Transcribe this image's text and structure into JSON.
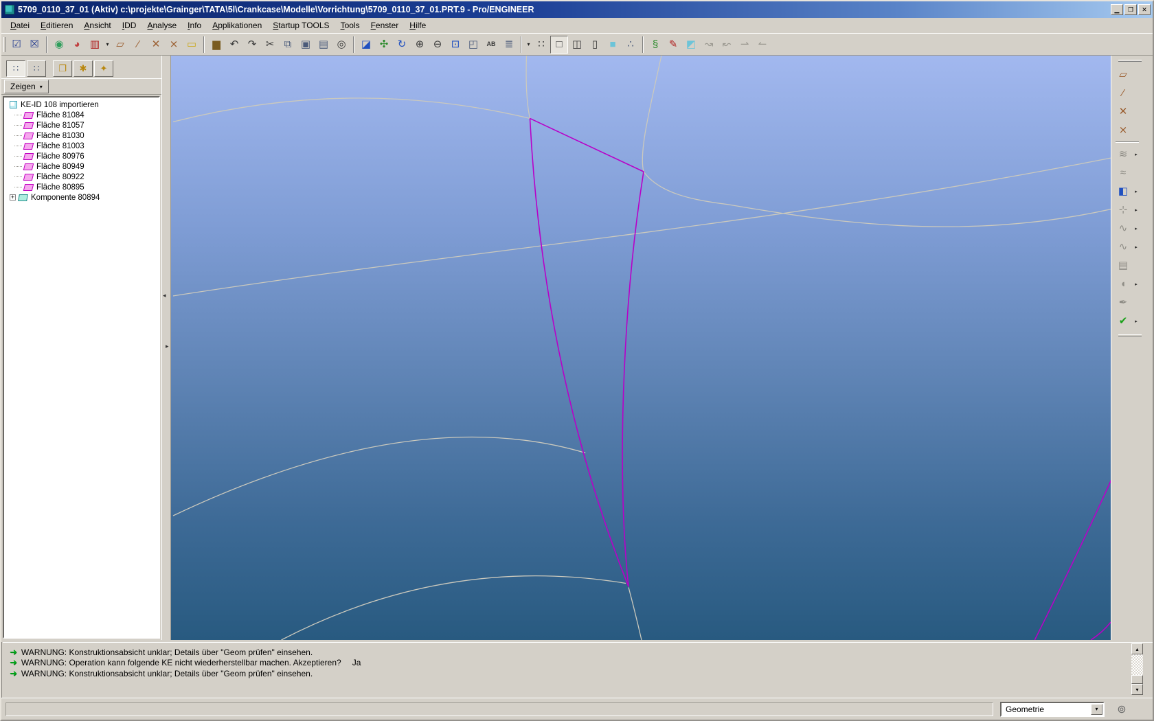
{
  "window": {
    "title": "5709_0110_37_01 (Aktiv) c:\\projekte\\Grainger\\TATA\\5l\\Crankcase\\Modelle\\Vorrichtung\\5709_0110_37_01.PRT.9 - Pro/ENGINEER"
  },
  "menu": {
    "items": [
      {
        "label": "Datei"
      },
      {
        "label": "Editieren"
      },
      {
        "label": "Ansicht"
      },
      {
        "label": "IDD"
      },
      {
        "label": "Analyse"
      },
      {
        "label": "Info"
      },
      {
        "label": "Applikationen"
      },
      {
        "label": "Startup TOOLS"
      },
      {
        "label": "Tools"
      },
      {
        "label": "Fenster"
      },
      {
        "label": "Hilfe"
      }
    ]
  },
  "left_panel": {
    "show_button": "Zeigen"
  },
  "tree": {
    "root_label": "KE-ID 108 importieren",
    "surfaces": [
      {
        "label": "Fläche 81084"
      },
      {
        "label": "Fläche 81057"
      },
      {
        "label": "Fläche 81030"
      },
      {
        "label": "Fläche 81003"
      },
      {
        "label": "Fläche 80976"
      },
      {
        "label": "Fläche 80949"
      },
      {
        "label": "Fläche 80922"
      },
      {
        "label": "Fläche 80895"
      }
    ],
    "component_label": "Komponente 80894"
  },
  "messages": {
    "lines": [
      {
        "text": "WARNUNG: Konstruktionsabsicht unklar; Details über \"Geom prüfen\" einsehen.",
        "response": ""
      },
      {
        "text": "WARNUNG: Operation kann folgende KE nicht wiederherstellbar machen. Akzeptieren?",
        "response": "Ja"
      },
      {
        "text": "WARNUNG: Konstruktionsabsicht unklar; Details über \"Geom prüfen\" einsehen.",
        "response": ""
      }
    ]
  },
  "statusbar": {
    "selector_value": "Geometrie"
  },
  "colors": {
    "highlight_magenta": "#b800c8",
    "wireframe_gray": "#cbc9bd",
    "viewport_top": "#a2b8ef",
    "viewport_bottom": "#285a80",
    "titlebar_start": "#0a246a",
    "titlebar_end": "#a6caf0"
  },
  "icons": {
    "confirm-window": "☑",
    "abort-window": "☒",
    "web-globe": "◉",
    "render-colors": "◕",
    "repaint": "▥",
    "dropdown": "▾",
    "datum-plane-display": "▱",
    "datum-axis-display": "⁄",
    "datum-point-display": "✕",
    "csys-display": "⨯",
    "annotation-display": "▭",
    "analysis-measure": "▆",
    "undo": "↶",
    "redo": "↷",
    "cut": "✂",
    "copy": "⧉",
    "paste": "▣",
    "paste-special": "▤",
    "find": "◎",
    "redraw": "◪",
    "spin-center": "✣",
    "orient-mode": "↻",
    "zoom-in": "⊕",
    "zoom-out": "⊖",
    "refit": "⊡",
    "saved-views": "◰",
    "named-views": "AB",
    "layers": "≣",
    "tree-filter": "∷",
    "wireframe": "□",
    "hidden-line": "◫",
    "no-hidden": "▯",
    "shaded": "■",
    "model-tree-toggle": "∴",
    "spin-center-toggle": "§",
    "annotate": "✎",
    "component-display": "◩",
    "edit-disabled-1": "↝",
    "edit-disabled-2": "↜",
    "edit-disabled-3": "⇀",
    "edit-disabled-4": "↼",
    "tab-model-tree": "∷",
    "tab-layer-tree": "∷",
    "tab-folders": "❐",
    "tab-favorites": "✱",
    "tab-connections": "✦",
    "datum-plane-tool": "▱",
    "datum-axis-tool": "⁄",
    "datum-point-tool": "✕",
    "csys-tool": "⨯",
    "style-tool": "≋",
    "surface-tool": "≈",
    "boundary-blend-tool": "◧",
    "point-tool": "⊹",
    "curve-tool": "∿",
    "curve-points-tool": "∿",
    "relations-doc": "▤",
    "trim-tool": "◖",
    "warp-tool": "✒",
    "done-check": "✔",
    "flyout": "▸",
    "warning-arrow": "➜",
    "plus": "+",
    "combo-arrow": "▾",
    "scroll-up": "▴",
    "scroll-down": "▾",
    "sash-left": "◂",
    "sash-right": "▸",
    "window-minimize": "▁",
    "window-restore": "❐",
    "window-close": "✕",
    "selection-filter": "⊚"
  }
}
